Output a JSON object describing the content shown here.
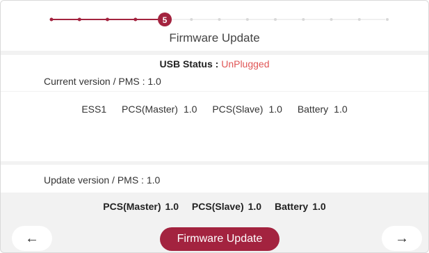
{
  "stepper": {
    "current_step": "5",
    "total_dots": 13,
    "active_color": "#a3233f",
    "inactive_color": "#d8d8d8"
  },
  "header": {
    "title": "Firmware Update"
  },
  "usb": {
    "label": "USB Status : ",
    "state": "UnPlugged",
    "state_color": "#e05555"
  },
  "current": {
    "label": "Current version / PMS : 1.0",
    "ess": "ESS1",
    "items": [
      {
        "name": "PCS(Master)",
        "version": "1.0"
      },
      {
        "name": "PCS(Slave)",
        "version": "1.0"
      },
      {
        "name": "Battery",
        "version": "1.0"
      }
    ]
  },
  "update": {
    "label": "Update version / PMS : 1.0",
    "items": [
      {
        "name": "PCS(Master)",
        "version": "1.0"
      },
      {
        "name": "PCS(Slave)",
        "version": "1.0"
      },
      {
        "name": "Battery",
        "version": "1.0"
      }
    ]
  },
  "footer": {
    "back_icon": "arrow-left-icon",
    "back_glyph": "←",
    "next_icon": "arrow-right-icon",
    "next_glyph": "→",
    "primary_label": "Firmware Update"
  }
}
